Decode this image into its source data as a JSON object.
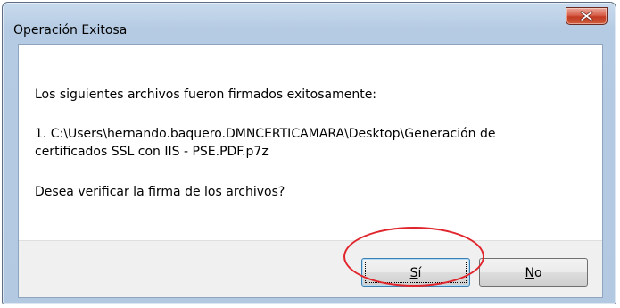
{
  "window": {
    "title": "Operación Exitosa"
  },
  "icons": {
    "close": "close-icon"
  },
  "message": {
    "line1": "Los siguientes archivos fueron firmados exitosamente:",
    "line2": "1. C:\\Users\\hernando.baquero.DMNCERTICAMARA\\Desktop\\Generación de",
    "line3": "certificados SSL con IIS - PSE.PDF.p7z",
    "line4": "Desea verificar la firma de los archivos?"
  },
  "buttons": {
    "yes_mnemonic": "S",
    "yes_rest": "í",
    "no_mnemonic": "N",
    "no_rest": "o"
  },
  "colors": {
    "annotation": "#e0262c",
    "close_button": "#c23b22"
  }
}
